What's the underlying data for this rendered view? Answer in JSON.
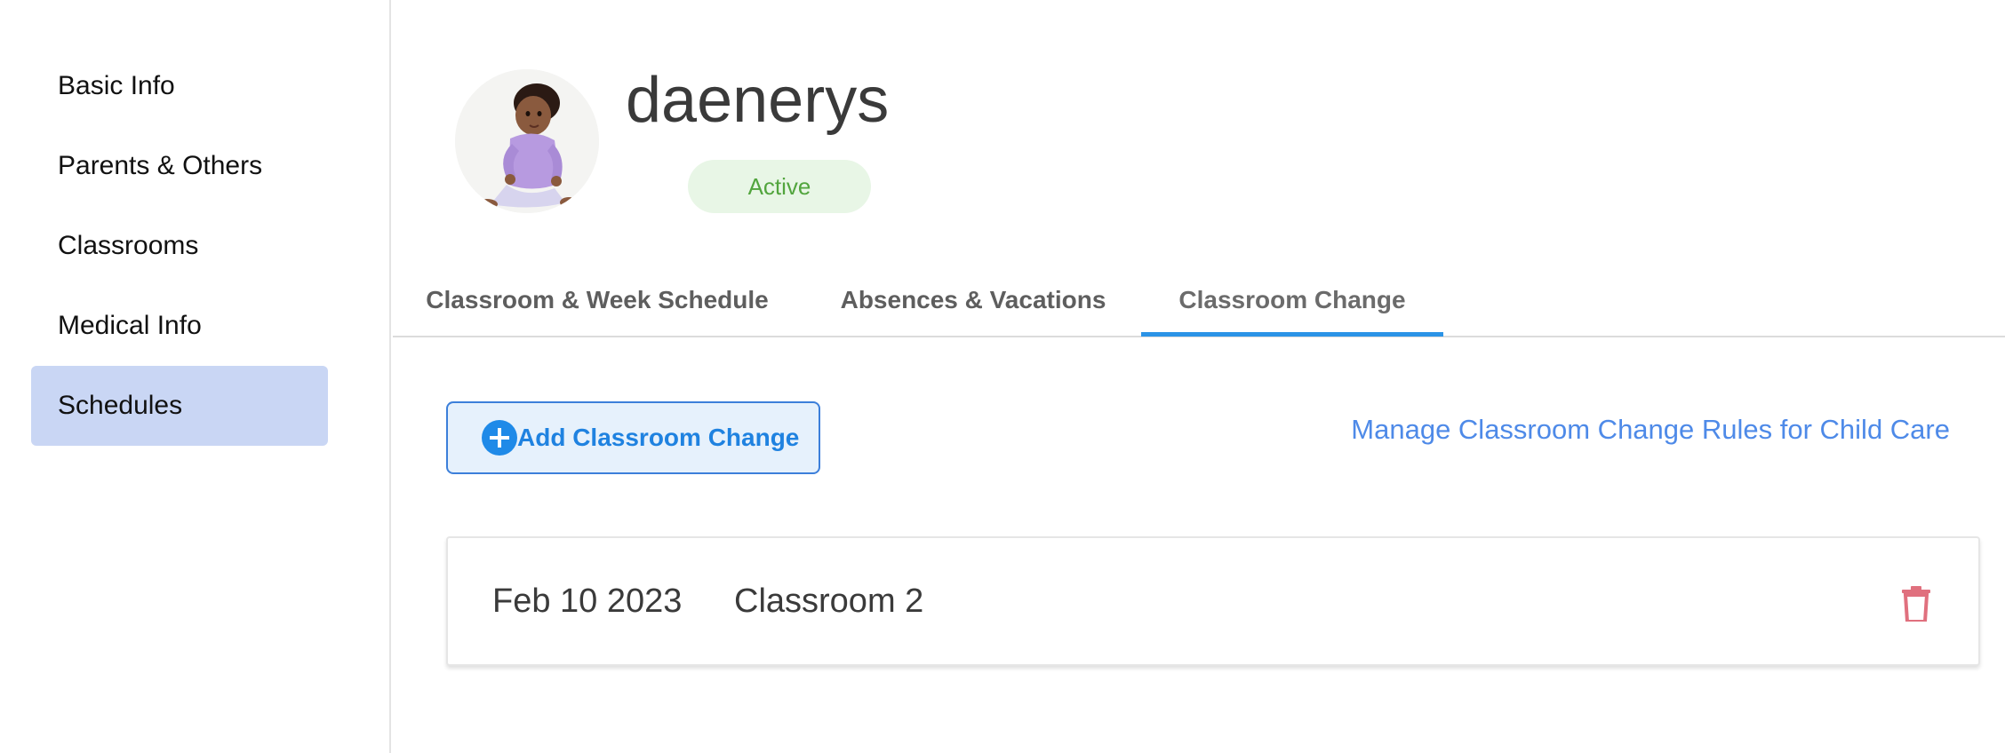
{
  "sidebar": {
    "items": [
      {
        "label": "Basic Info"
      },
      {
        "label": "Parents & Others"
      },
      {
        "label": "Classrooms"
      },
      {
        "label": "Medical Info"
      },
      {
        "label": "Schedules"
      }
    ],
    "active_index": 4,
    "active_color": "#c9d6f4"
  },
  "profile": {
    "name": "daenerys",
    "status": "Active",
    "status_color": "#52a53e"
  },
  "tabs": [
    {
      "label": "Classroom & Week Schedule"
    },
    {
      "label": "Absences & Vacations"
    },
    {
      "label": "Classroom Change"
    }
  ],
  "active_tab_index": 2,
  "accent_color": "#2b93e6",
  "actions": {
    "add_label": "Add Classroom Change",
    "manage_link": "Manage Classroom Change Rules for Child Care"
  },
  "classroom_changes": [
    {
      "date": "Feb 10 2023",
      "classroom": "Classroom 2"
    }
  ],
  "icons": {
    "add": "plus-circle-icon",
    "delete": "trash-icon"
  }
}
